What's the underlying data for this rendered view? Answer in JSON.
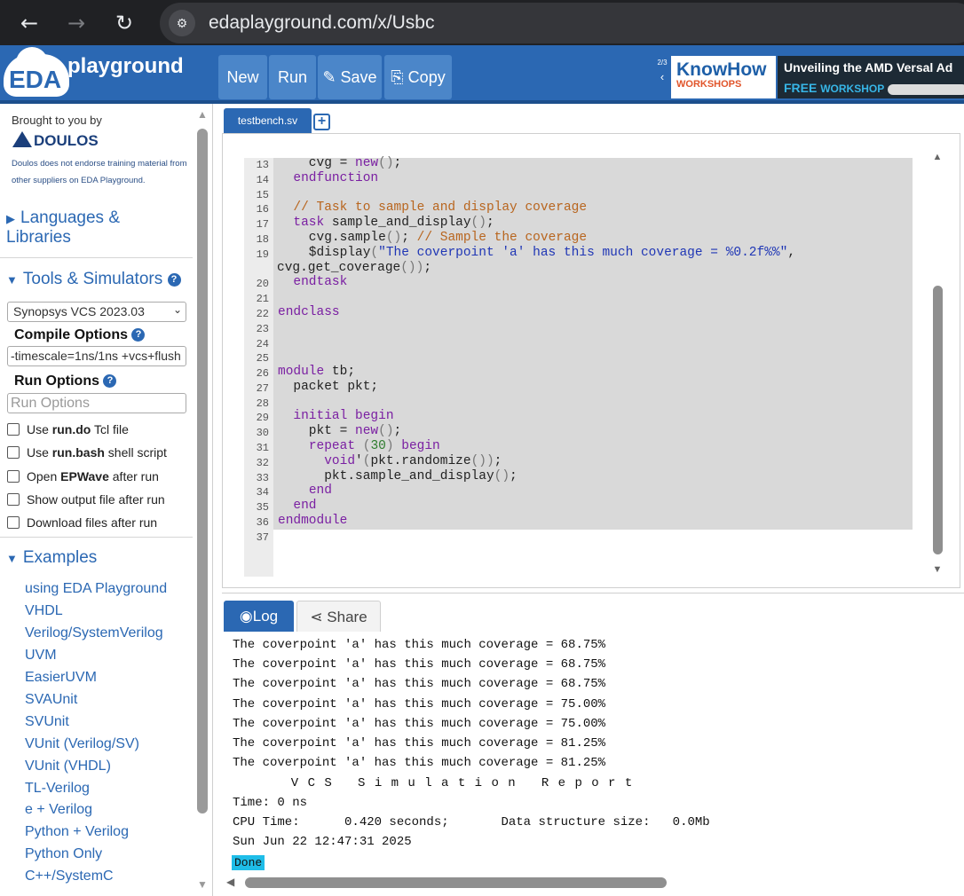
{
  "browser": {
    "back_icon": "←",
    "forward_icon": "→",
    "reload_icon": "↻",
    "site_info_icon": "⚙",
    "url": "edaplayground.com/x/Usbc"
  },
  "header": {
    "logo_eda": "EDA",
    "logo_playground": "playground",
    "buttons": {
      "new": "New",
      "run": "Run",
      "save": "✎ Save",
      "copy": "⎘ Copy"
    },
    "ad": {
      "counter": "2/3",
      "prev_icon": "‹",
      "knowhow_top": "KnowHow",
      "knowhow_bottom": "WORKSHOPS",
      "title": "Unveiling the AMD Versal Ad",
      "free": "FREE",
      "workshop": "WORKSHOP"
    }
  },
  "sidebar": {
    "brought": "Brought to you by",
    "doulos": "DOULOS",
    "disclaimer": "Doulos does not endorse training material from other suppliers on EDA Playground.",
    "languages": "Languages & Libraries",
    "tools": "Tools & Simulators",
    "simulator": "Synopsys VCS 2023.03",
    "compile_label": "Compile Options",
    "compile_value": "-timescale=1ns/1ns +vcs+flush",
    "run_label": "Run Options",
    "run_placeholder": "Run Options",
    "checks": [
      {
        "pre": "Use ",
        "bold": "run.do",
        "post": " Tcl file"
      },
      {
        "pre": "Use ",
        "bold": "run.bash",
        "post": " shell script"
      },
      {
        "pre": "Open ",
        "bold": "EPWave",
        "post": " after run"
      },
      {
        "pre": "Show output file after run",
        "bold": "",
        "post": ""
      },
      {
        "pre": "Download files after run",
        "bold": "",
        "post": ""
      }
    ],
    "examples_title": "Examples",
    "examples": [
      "using EDA Playground",
      "VHDL",
      "Verilog/SystemVerilog",
      "UVM",
      "EasierUVM",
      "SVAUnit",
      "SVUnit",
      "VUnit (Verilog/SV)",
      "VUnit (VHDL)",
      "TL-Verilog",
      "e + Verilog",
      "Python + Verilog",
      "Python Only",
      "C++/SystemC"
    ]
  },
  "editor": {
    "tab": "testbench.sv",
    "add_tab": "+",
    "line_numbers": [
      "13",
      "14",
      "15",
      "16",
      "17",
      "18",
      "19",
      "",
      "20",
      "21",
      "22",
      "23",
      "24",
      "25",
      "26",
      "27",
      "28",
      "29",
      "30",
      "31",
      "32",
      "33",
      "34",
      "35",
      "36",
      "37"
    ]
  },
  "log": {
    "log_tab": "Log",
    "share_tab": "Share",
    "lines": [
      "The coverpoint 'a' has this much coverage = 68.75%",
      "The coverpoint 'a' has this much coverage = 68.75%",
      "The coverpoint 'a' has this much coverage = 68.75%",
      "The coverpoint 'a' has this much coverage = 75.00%",
      "The coverpoint 'a' has this much coverage = 75.00%",
      "The coverpoint 'a' has this much coverage = 81.25%",
      "The coverpoint 'a' has this much coverage = 81.25%",
      "       V C S   S i m u l a t i o n   R e p o r t",
      "Time: 0 ns",
      "CPU Time:      0.420 seconds;       Data structure size:   0.0Mb",
      "Sun Jun 22 12:47:31 2025"
    ],
    "done": "Done"
  },
  "colors": {
    "brand": "#2b68b3",
    "done_badge": "#1fbde8"
  }
}
